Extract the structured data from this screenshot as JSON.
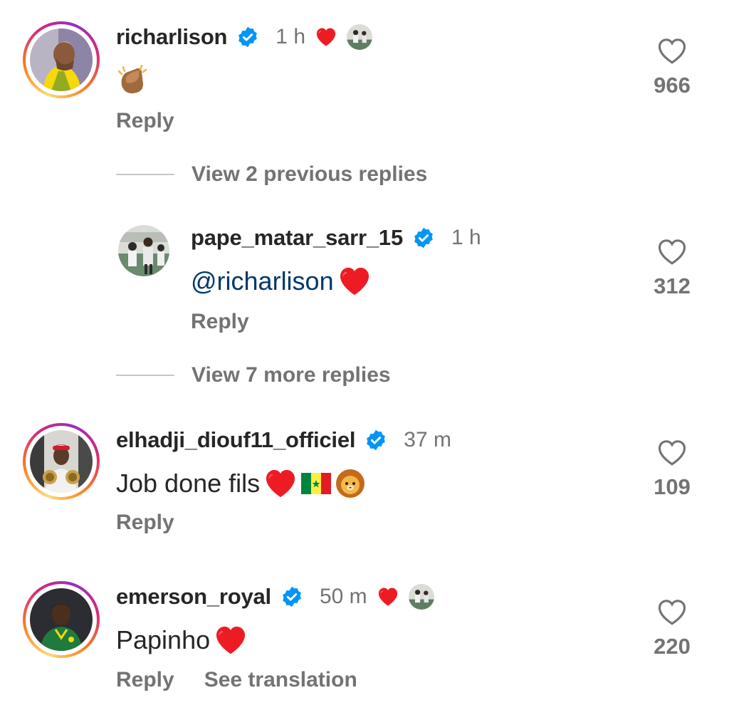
{
  "comments": [
    {
      "username": "richarlison",
      "time": "1 h",
      "text": "",
      "likes": "966",
      "reply_label": "Reply",
      "creator_liked": true,
      "emoji": "clapping-hands"
    },
    {
      "username": "pape_matar_sarr_15",
      "time": "1 h",
      "mention": "@richarlison",
      "likes": "312",
      "reply_label": "Reply"
    },
    {
      "username": "elhadji_diouf11_officiel",
      "time": "37 m",
      "text": "Job done fils",
      "likes": "109",
      "reply_label": "Reply"
    },
    {
      "username": "emerson_royal",
      "time": "50 m",
      "text": "Papinho",
      "likes": "220",
      "reply_label": "Reply",
      "translate_label": "See translation",
      "creator_liked": true
    }
  ],
  "view_previous_replies": "View 2 previous replies",
  "view_more_replies": "View 7 more replies",
  "colors": {
    "verified": "#0095f6",
    "heart": "#ff3040",
    "muted": "#737373",
    "mention": "#00376b"
  }
}
